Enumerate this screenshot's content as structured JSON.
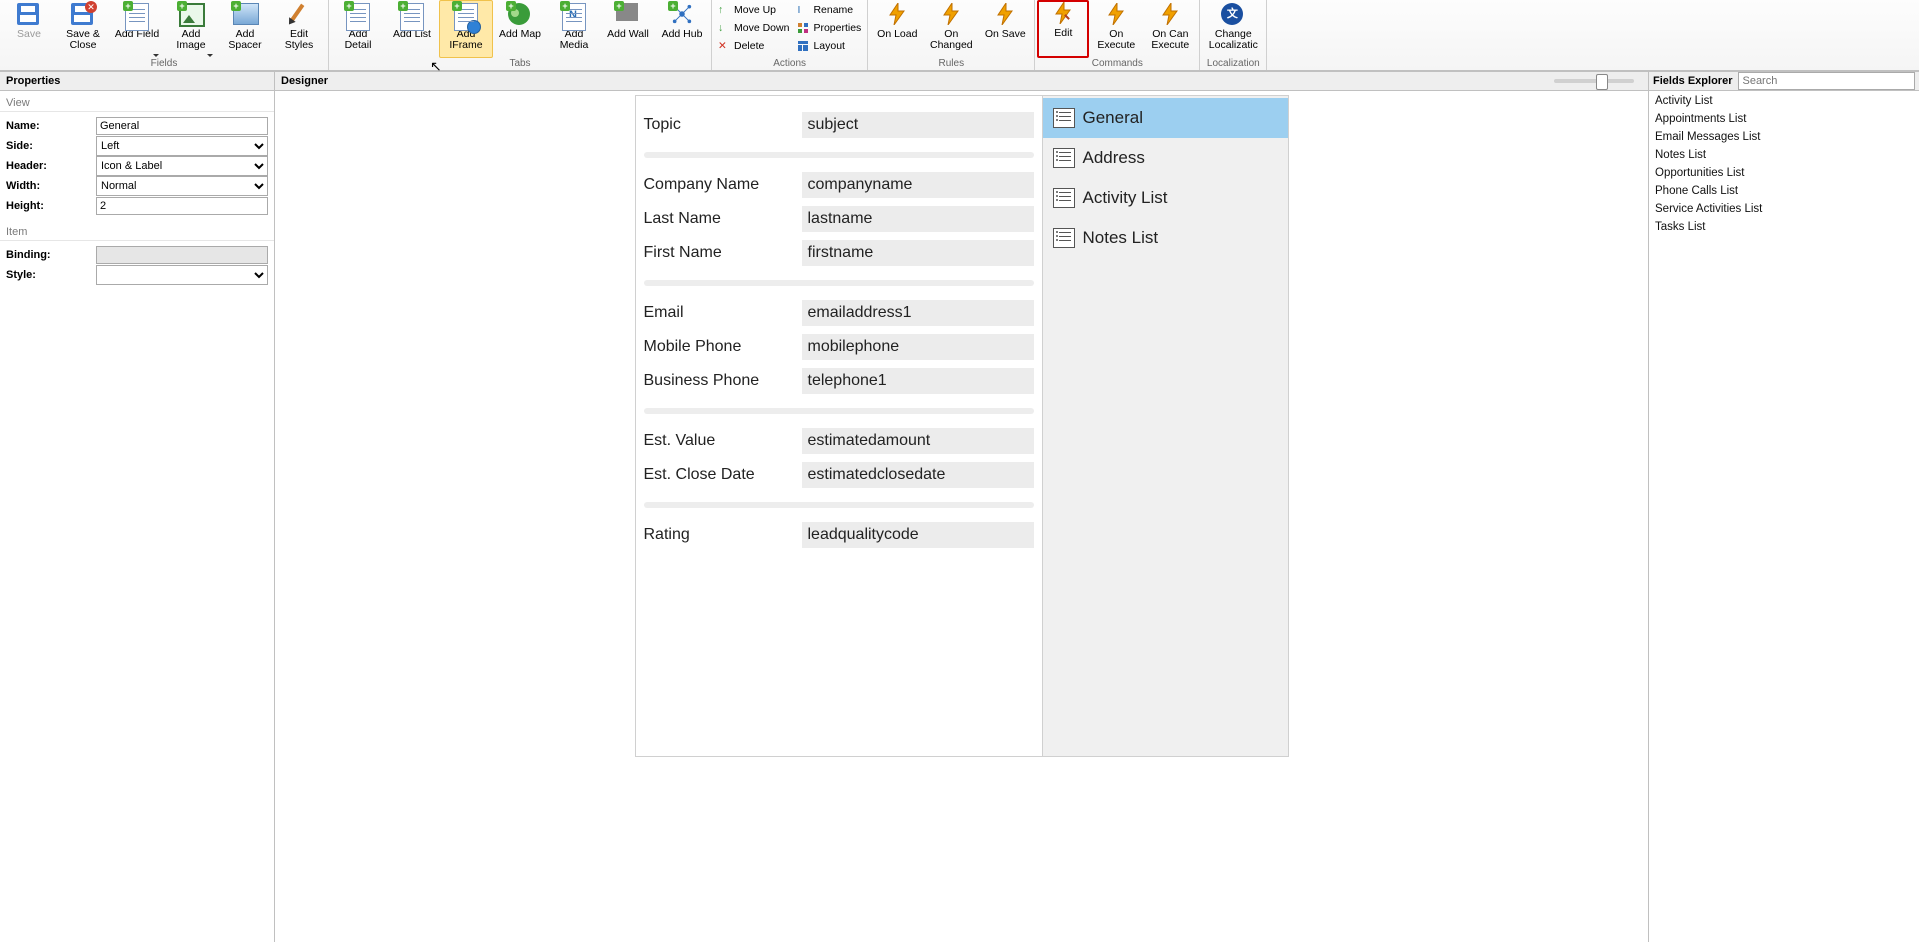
{
  "ribbon": {
    "groups": {
      "fields": {
        "label": "Fields",
        "buttons": {
          "save": "Save",
          "save_close": "Save & Close",
          "add_field": "Add Field",
          "add_image": "Add Image",
          "add_spacer": "Add Spacer",
          "edit_styles": "Edit Styles"
        }
      },
      "tabs": {
        "label": "Tabs",
        "buttons": {
          "add_detail": "Add Detail",
          "add_list": "Add List",
          "add_iframe": "Add IFrame",
          "add_map": "Add Map",
          "add_media": "Add Media",
          "add_wall": "Add Wall",
          "add_hub": "Add Hub"
        }
      },
      "actions": {
        "label": "Actions",
        "buttons": {
          "move_up": "Move Up",
          "move_down": "Move Down",
          "delete": "Delete",
          "rename": "Rename",
          "properties": "Properties",
          "layout": "Layout"
        }
      },
      "rules": {
        "label": "Rules",
        "buttons": {
          "on_load": "On Load",
          "on_changed": "On Changed",
          "on_save": "On Save"
        }
      },
      "commands": {
        "label": "Commands",
        "buttons": {
          "edit": "Edit",
          "on_execute": "On Execute",
          "on_can_execute": "On Can Execute"
        }
      },
      "localization": {
        "label": "Localization",
        "buttons": {
          "change_localization": "Change Localizatic"
        }
      }
    }
  },
  "panels": {
    "properties_title": "Properties",
    "designer_title": "Designer",
    "explorer_title": "Fields Explorer",
    "search_placeholder": "Search"
  },
  "properties": {
    "sections": {
      "view": "View",
      "item": "Item"
    },
    "labels": {
      "name": "Name:",
      "side": "Side:",
      "header": "Header:",
      "width": "Width:",
      "height": "Height:",
      "binding": "Binding:",
      "style": "Style:"
    },
    "values": {
      "name": "General",
      "side": "Left",
      "header": "Icon & Label",
      "width": "Normal",
      "height": "2",
      "binding": "",
      "style": ""
    }
  },
  "designer": {
    "fieldGroups": [
      [
        {
          "label": "Topic",
          "binding": "subject"
        }
      ],
      [
        {
          "label": "Company Name",
          "binding": "companyname"
        },
        {
          "label": "Last Name",
          "binding": "lastname"
        },
        {
          "label": "First Name",
          "binding": "firstname"
        }
      ],
      [
        {
          "label": "Email",
          "binding": "emailaddress1"
        },
        {
          "label": "Mobile Phone",
          "binding": "mobilephone"
        },
        {
          "label": "Business Phone",
          "binding": "telephone1"
        }
      ],
      [
        {
          "label": "Est. Value",
          "binding": "estimatedamount"
        },
        {
          "label": "Est. Close Date",
          "binding": "estimatedclosedate"
        }
      ],
      [
        {
          "label": "Rating",
          "binding": "leadqualitycode"
        }
      ]
    ],
    "tabs": [
      {
        "label": "General",
        "active": true
      },
      {
        "label": "Address",
        "active": false
      },
      {
        "label": "Activity List",
        "active": false
      },
      {
        "label": "Notes List",
        "active": false
      }
    ]
  },
  "explorer": {
    "items": [
      "Activity List",
      "Appointments List",
      "Email Messages List",
      "Notes List",
      "Opportunities List",
      "Phone Calls List",
      "Service Activities List",
      "Tasks List"
    ]
  }
}
